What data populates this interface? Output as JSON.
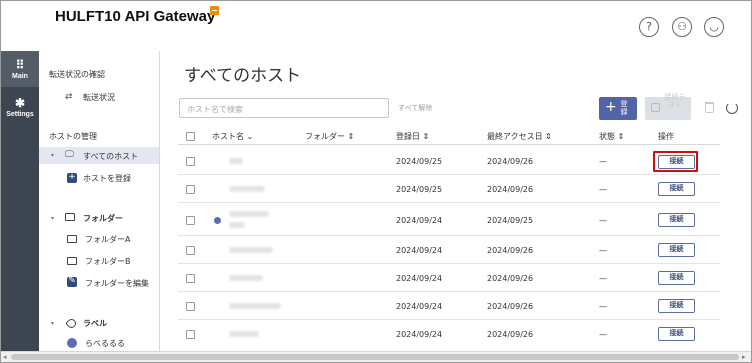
{
  "app": {
    "title": "HULFT10 API Gateway"
  },
  "header_icons": [
    "help-icon",
    "org-icon",
    "user-icon"
  ],
  "rail": [
    {
      "label": "Main",
      "icon": "grid-icon",
      "active": true
    },
    {
      "label": "Settings",
      "icon": "gear-icon",
      "active": false
    }
  ],
  "sidebar": {
    "status_section": "転送状況の確認",
    "status_item": "転送状況",
    "host_section": "ホストの管理",
    "all_hosts": "すべてのホスト",
    "register_host": "ホストを登録",
    "folder_section": "フォルダー",
    "folders": [
      "フォルダーA",
      "フォルダーB"
    ],
    "edit_folder": "フォルダーを編集",
    "label_section": "ラベル",
    "label_item": "らべるるる"
  },
  "main": {
    "title": "すべてのホスト",
    "search_placeholder": "ホスト名で検索",
    "clear_all": "すべて解除",
    "register_button": "登録",
    "test_button": "接続テスト",
    "columns": {
      "host": "ホスト名",
      "folder": "フォルダー",
      "registered": "登録日",
      "last_access": "最終アクセス日",
      "status": "状態",
      "action": "操作"
    },
    "connect_label": "接続",
    "rows": [
      {
        "registered": "2024/09/25",
        "last_access": "2024/09/26",
        "status": "—"
      },
      {
        "registered": "2024/09/25",
        "last_access": "2024/09/26",
        "status": "—"
      },
      {
        "registered": "2024/09/24",
        "last_access": "2024/09/25",
        "status": "—"
      },
      {
        "registered": "2024/09/24",
        "last_access": "2024/09/26",
        "status": "—"
      },
      {
        "registered": "2024/09/24",
        "last_access": "2024/09/26",
        "status": "—"
      },
      {
        "registered": "2024/09/24",
        "last_access": "2024/09/26",
        "status": "—"
      },
      {
        "registered": "2024/09/24",
        "last_access": "2024/09/26",
        "status": "—"
      }
    ]
  },
  "colors": {
    "accent": "#5264a8",
    "rail": "#3d4551",
    "highlight": "#d10f0f"
  }
}
